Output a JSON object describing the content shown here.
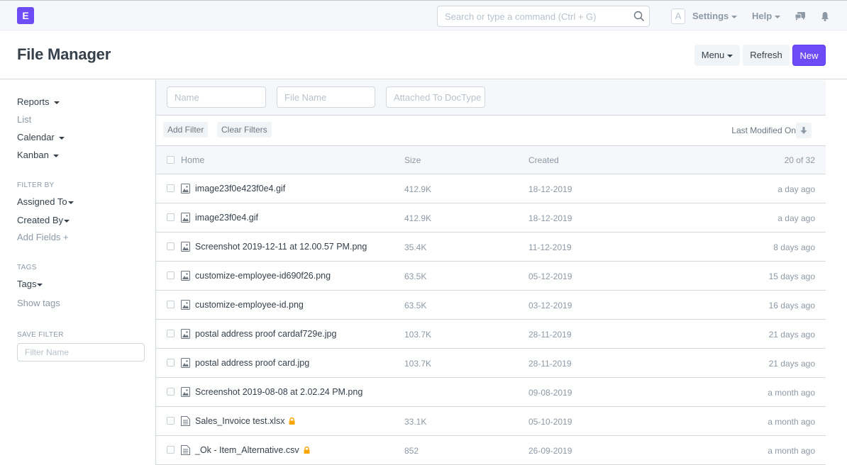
{
  "navbar": {
    "logo_letter": "E",
    "search_placeholder": "Search or type a command (Ctrl + G)",
    "avatar_letter": "A",
    "settings_label": "Settings",
    "help_label": "Help",
    "icons": [
      "search-icon",
      "chat-icon",
      "bell-icon"
    ]
  },
  "page": {
    "title": "File Manager",
    "menu_label": "Menu",
    "refresh_label": "Refresh",
    "new_label": "New",
    "accent_color": "#6e4cf5"
  },
  "sidebar": {
    "views": [
      {
        "label": "Reports",
        "dropdown": true
      },
      {
        "label": "List",
        "dropdown": false
      },
      {
        "label": "Calendar",
        "dropdown": true
      },
      {
        "label": "Kanban",
        "dropdown": true
      }
    ],
    "filter_by_heading": "FILTER BY",
    "filter_by": [
      {
        "label": "Assigned To"
      },
      {
        "label": "Created By"
      }
    ],
    "add_fields_label": "Add Fields +",
    "tags_heading": "TAGS",
    "tags_label": "Tags",
    "show_tags_label": "Show tags",
    "save_filter_heading": "SAVE FILTER",
    "filter_name_placeholder": "Filter Name"
  },
  "list": {
    "standard_filters": {
      "name_placeholder": "Name",
      "file_name_placeholder": "File Name",
      "attached_to_placeholder": "Attached To DocType"
    },
    "add_filter_label": "Add Filter",
    "clear_filters_label": "Clear Filters",
    "sort_label": "Last Modified On",
    "columns": {
      "name": "Home",
      "size": "Size",
      "created": "Created",
      "count": "20 of 32"
    },
    "rows": [
      {
        "icon": "image-icon",
        "name": "image23f0e423f0e4.gif",
        "size": "412.9K",
        "created": "18-12-2019",
        "modified": "a day ago",
        "locked": false
      },
      {
        "icon": "image-icon",
        "name": "image23f0e4.gif",
        "size": "412.9K",
        "created": "18-12-2019",
        "modified": "a day ago",
        "locked": false
      },
      {
        "icon": "image-icon",
        "name": "Screenshot 2019-12-11 at 12.00.57 PM.png",
        "size": "35.4K",
        "created": "11-12-2019",
        "modified": "8 days ago",
        "locked": false
      },
      {
        "icon": "image-icon",
        "name": "customize-employee-id690f26.png",
        "size": "63.5K",
        "created": "05-12-2019",
        "modified": "15 days ago",
        "locked": false
      },
      {
        "icon": "image-icon",
        "name": "customize-employee-id.png",
        "size": "63.5K",
        "created": "03-12-2019",
        "modified": "16 days ago",
        "locked": false
      },
      {
        "icon": "image-icon",
        "name": "postal address proof cardaf729e.jpg",
        "size": "103.7K",
        "created": "28-11-2019",
        "modified": "21 days ago",
        "locked": false
      },
      {
        "icon": "image-icon",
        "name": "postal address proof card.jpg",
        "size": "103.7K",
        "created": "28-11-2019",
        "modified": "21 days ago",
        "locked": false
      },
      {
        "icon": "image-icon",
        "name": "Screenshot 2019-08-08 at 2.02.24 PM.png",
        "size": "",
        "created": "09-08-2019",
        "modified": "a month ago",
        "locked": false
      },
      {
        "icon": "document-icon",
        "name": "Sales_Invoice test.xlsx",
        "size": "33.1K",
        "created": "05-10-2019",
        "modified": "a month ago",
        "locked": true
      },
      {
        "icon": "document-icon",
        "name": "_Ok - Item_Alternative.csv",
        "size": "852",
        "created": "26-09-2019",
        "modified": "a month ago",
        "locked": true
      }
    ],
    "lock_color": "#f8a500"
  }
}
